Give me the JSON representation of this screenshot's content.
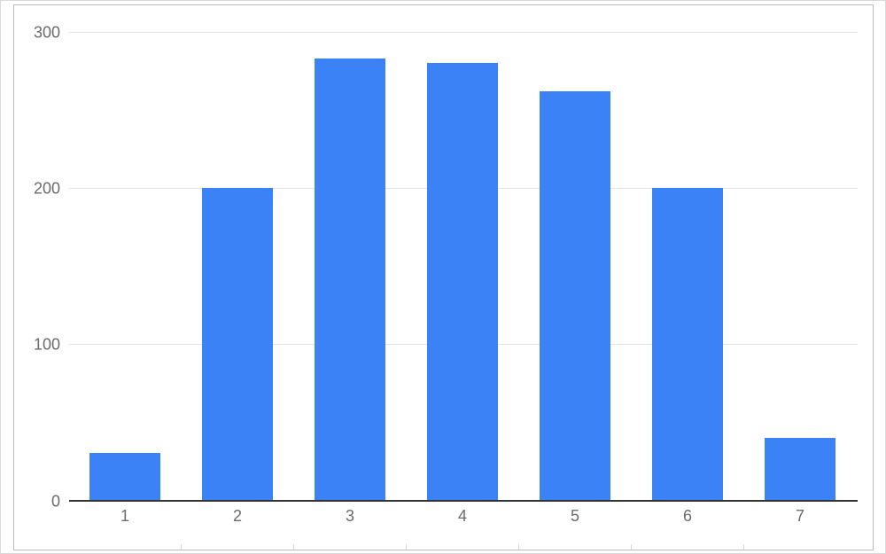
{
  "chart_data": {
    "type": "bar",
    "categories": [
      "1",
      "2",
      "3",
      "4",
      "5",
      "6",
      "7"
    ],
    "values": [
      30,
      200,
      283,
      280,
      262,
      200,
      40
    ],
    "y_ticks": [
      0,
      100,
      200,
      300
    ],
    "ylim": [
      0,
      300
    ],
    "title": "",
    "xlabel": "",
    "ylabel": "",
    "bar_color": "#3b82f6",
    "grid_color": "#e4e4e4",
    "axis_color": "#333333"
  }
}
